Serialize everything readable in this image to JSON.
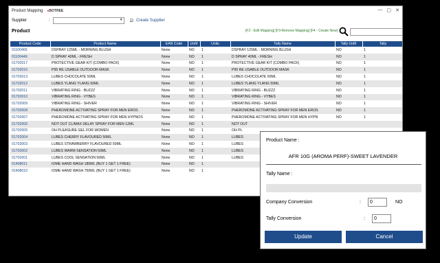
{
  "window": {
    "title": "Product Mapping",
    "brand_name": "BOTREE",
    "controls": [
      "—",
      "▢",
      "✕"
    ]
  },
  "supplier": {
    "label": "Supplier",
    "colon": ":",
    "value": "",
    "checkbox_mark": "☑",
    "create_label": "Create Supplier"
  },
  "product_heading": "Product",
  "shortcuts": "[F2 - Edit Mapping] [F3-Remove Mapping] [F4 - Create New]",
  "search": {
    "value": ""
  },
  "table": {
    "columns": [
      "Product Code",
      "Product Name",
      "EAN Code",
      "UoM",
      "Units",
      "Tally Name",
      "Tally UoM",
      "Tally"
    ],
    "rows": [
      [
        "01100465",
        "DSPRAY 125ML - MORNING BLUSH",
        "None",
        "NO",
        "1",
        "DSPRAY 125ML - MORNING BLUSH",
        "NO",
        "1"
      ],
      [
        "01100449",
        "D SPRAY 40ML - FRESH",
        "None",
        "NO",
        "1",
        "D SPRAY 40ML - FRESH",
        "NO",
        "1"
      ],
      [
        "01702017",
        "PROTECTIVE GEAR KIT (COMBO PACK)",
        "None",
        "NO",
        "1",
        "PROTECTIVE GEAR KIT (COMBO PACK)",
        "NO",
        "1"
      ],
      [
        "01702016",
        "P95 RE USABLE OUTDOOR MASK",
        "None",
        "NO",
        "1",
        "P95 RE USABLE OUTDOOR MASK",
        "NO",
        "1"
      ],
      [
        "01702013",
        "LUBES CHOCOLATE 50ML",
        "None",
        "NO",
        "1",
        "LUBES CHOCOLATE 50ML",
        "NO",
        "1"
      ],
      [
        "01702012",
        "LUBES YLANG YLANG 50ML",
        "None",
        "NO",
        "1",
        "LUBES YLANG YLANG 50ML",
        "NO",
        "1"
      ],
      [
        "01702011",
        "VIBRATING RING - BUZZZ",
        "None",
        "NO",
        "1",
        "VIBRATING RING - BUZZZ",
        "NO",
        "1"
      ],
      [
        "01702010",
        "VIBRATING RING - VYBES",
        "None",
        "NO",
        "1",
        "VIBRATING RING - VYBES",
        "NO",
        "1"
      ],
      [
        "01702009",
        "VIBRATING RING - SHIVER",
        "None",
        "NO",
        "1",
        "VIBRATING RING - SHIVER",
        "NO",
        "1"
      ],
      [
        "01702008",
        "PHEROMONE ACTIVATING SPRAY FOR MEN EROS",
        "None",
        "NO",
        "1",
        "PHEROMONE ACTIVATING SPRAY FOR MEN EROS",
        "NO",
        "1"
      ],
      [
        "01702007",
        "PHEROMONE ACTIVATING SPRAY FOR MEN HYPNOS",
        "None",
        "NO",
        "1",
        "PHEROMONE ACTIVATING SPRAY FOR MEN HYPN",
        "NO",
        "1"
      ],
      [
        "01702006",
        "NOT OUT CLIMAX DELAY SPRAY FOR MEN 12ML",
        "None",
        "NO",
        "1",
        "NOT OUT",
        "",
        ""
      ],
      [
        "01702005",
        "OH PLEASURE GEL FOR WOMEN",
        "None",
        "NO",
        "1",
        "OH PL",
        "",
        ""
      ],
      [
        "01702004",
        "LUBES CHERRY FLAVOURED 50ML",
        "None",
        "NO",
        "1",
        "LUBES",
        "",
        ""
      ],
      [
        "01702003",
        "LUBES STRAWBERRY FLAVOURED 50ML",
        "None",
        "NO",
        "1",
        "LUBES",
        "",
        ""
      ],
      [
        "01702002",
        "LUBES WARM SENSATION 50ML",
        "None",
        "NO",
        "1",
        "LUBES",
        "",
        ""
      ],
      [
        "01702001",
        "LUBES COOL SENSATION 50ML",
        "None",
        "NO",
        "1",
        "LUBES",
        "",
        ""
      ],
      [
        "01408011",
        "IOME HAND WASH 180ML (BUY 1 GET 1 FREE)",
        "None",
        "NO",
        "1",
        "",
        "",
        ""
      ],
      [
        "01408010",
        "IOME HAND WASH 750ML (BUY 1 GET 1 FREE)",
        "None",
        "NO",
        "1",
        "",
        "",
        ""
      ]
    ]
  },
  "dialog": {
    "product_name_label": "Product Name :",
    "product_name_value": "AFR 10G (AROMA PERF)-SWEET LAVENDER",
    "tally_name_label": "Tally Name :",
    "company_conversion_label": "Company Conversion",
    "company_conversion_colon": ":",
    "company_conversion_value": "0",
    "company_conversion_uom": "NO",
    "tally_conversion_label": "Tally Conversion",
    "tally_conversion_colon": ":",
    "tally_conversion_value": "0",
    "update_label": "Update",
    "cancel_label": "Cancel"
  },
  "colors": {
    "header_blue": "#1f4d8c",
    "shortcut_green": "#2a7a2a",
    "row_alt": "#e6e6e6"
  }
}
